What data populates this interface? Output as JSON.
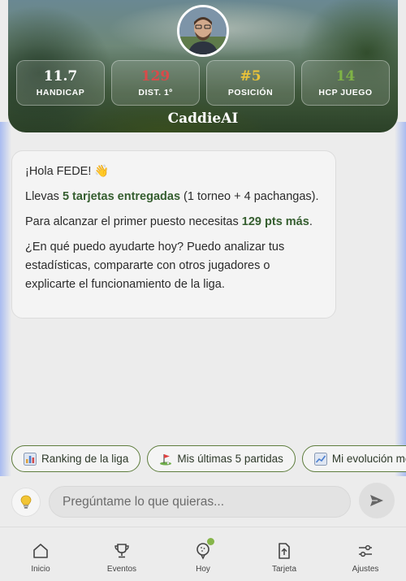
{
  "header": {
    "brand": "CaddieAI",
    "stats": [
      {
        "value": "11.7",
        "label": "HANDICAP",
        "color": "#ffffff"
      },
      {
        "value": "129",
        "label": "DIST. 1º",
        "color": "#d94a4a"
      },
      {
        "value": "#5",
        "label": "POSICIÓN",
        "color": "#e8c23a"
      },
      {
        "value": "14",
        "label": "HCP JUEGO",
        "color": "#7fb346"
      }
    ]
  },
  "message": {
    "greeting": "¡Hola FEDE! 👋",
    "line1_pre": "Llevas ",
    "line1_bold": "5 tarjetas entregadas",
    "line1_post": " (1 torneo + 4 pachangas).",
    "line2_pre": "Para alcanzar el primer puesto necesitas ",
    "line2_bold": "129 pts más",
    "line2_post": ".",
    "line3": "¿En qué puedo ayudarte hoy? Puedo analizar tus estadísticas, compararte con otros jugadores o explicarte el funcionamiento de la liga."
  },
  "chips": [
    {
      "label": "Ranking de la liga",
      "icon": "bar-chart-icon"
    },
    {
      "label": "Mis últimas 5 partidas",
      "icon": "golf-flag-icon"
    },
    {
      "label": "Mi evolución mensual",
      "icon": "trend-chart-icon"
    }
  ],
  "composer": {
    "placeholder": "Pregúntame lo que quieras...",
    "bulb_icon": "lightbulb-icon",
    "send_icon": "send-icon"
  },
  "nav": [
    {
      "label": "Inicio",
      "icon": "home-icon"
    },
    {
      "label": "Eventos",
      "icon": "trophy-icon"
    },
    {
      "label": "Hoy",
      "icon": "golf-ball-icon",
      "active": true
    },
    {
      "label": "Tarjeta",
      "icon": "upload-card-icon"
    },
    {
      "label": "Ajustes",
      "icon": "sliders-icon"
    }
  ],
  "colors": {
    "accent_green": "#355e2f",
    "chip_border": "#5e7d3d",
    "active_dot": "#86b54a"
  }
}
